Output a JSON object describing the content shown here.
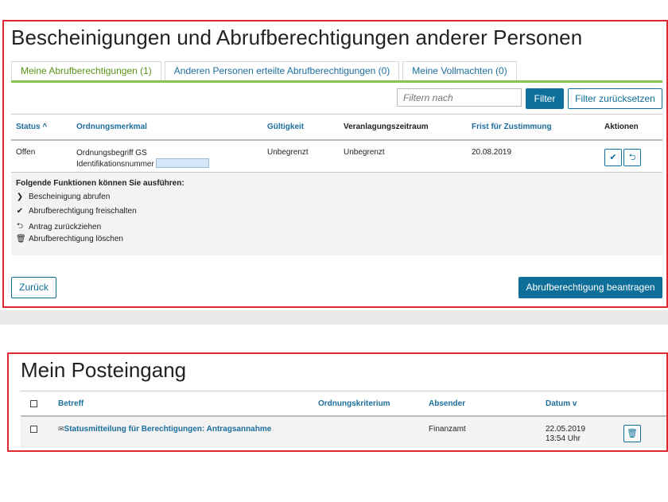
{
  "section1": {
    "title": "Bescheinigungen und Abrufberechtigungen anderer Personen",
    "tabs": [
      {
        "label": "Meine Abrufberechtigungen (1)"
      },
      {
        "label": "Anderen Personen erteilte Abrufberechtigungen (0)"
      },
      {
        "label": "Meine Vollmachten (0)"
      }
    ],
    "filter_placeholder": "Filtern nach",
    "filter_button": "Filter",
    "reset_button": "Filter zurücksetzen",
    "columns": [
      "Status",
      "Ordnungsmerkmal",
      "Gültigkeit",
      "Veranlagungszeitraum",
      "Frist für Zustimmung",
      "Aktionen"
    ],
    "sort_indicator": "^",
    "row": {
      "status": "Offen",
      "ordnung_line1": "Ordnungsbegriff  GS",
      "ordnung_line2": "Identifikationsnummer",
      "gueltigkeit": "Unbegrenzt",
      "zeitraum": "Unbegrenzt",
      "frist": "20.08.2019"
    },
    "functions_title": "Folgende Funktionen können Sie ausführen:",
    "functions": [
      {
        "icon": "chevron-right-icon",
        "label": "Bescheinigung abrufen"
      },
      {
        "icon": "check-icon",
        "label": "Abrufberechtigung freischalten"
      },
      {
        "icon": "undo-icon",
        "label": "Antrag zurückziehen"
      },
      {
        "icon": "trash-icon",
        "label": "Abrufberechtigung löschen"
      }
    ],
    "back_button": "Zurück",
    "request_button": "Abrufberechtigung beantragen"
  },
  "section2": {
    "title": "Mein Posteingang",
    "columns": [
      "Betreff",
      "Ordnungskriterium",
      "Absender",
      "Datum"
    ],
    "sort_indicator": "v",
    "row": {
      "betreff": "Statusmitteilung für Berechtigungen: Antragsannahme",
      "absender": "Finanzamt",
      "datum": "22.05.2019",
      "zeit": "13:54 Uhr"
    }
  },
  "colors": {
    "primary": "#0e6f9a",
    "link": "#1c6e9c",
    "active_tab": "#5a9419",
    "tab_line": "#8bc34a",
    "highlight": "#e0262e"
  }
}
